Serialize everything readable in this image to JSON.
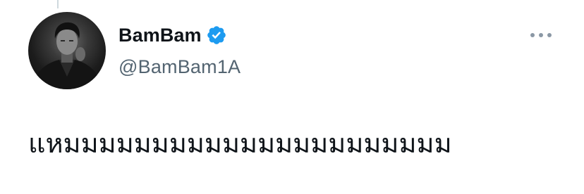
{
  "tweet": {
    "author": {
      "display_name": "BamBam",
      "handle": "@BamBam1A",
      "verified": true,
      "avatar_icon": "profile-photo"
    },
    "more_icon": "more-horizontal-icon",
    "text": "แหมมมมมมมมมมมมมมมมมมมมมม"
  },
  "colors": {
    "verified_badge": "#1d9bf0",
    "handle_gray": "#536471",
    "text": "#0f1419",
    "more_dots": "#8b98a5"
  }
}
